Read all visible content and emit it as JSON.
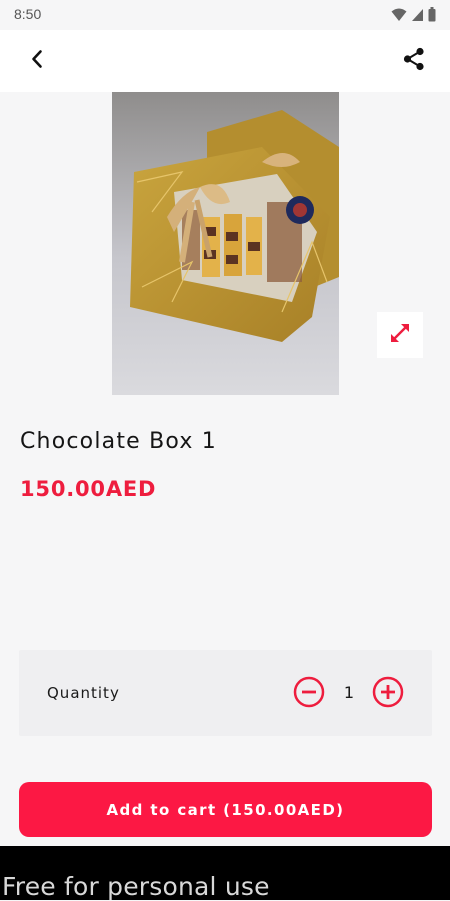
{
  "status_bar": {
    "time": "8:50",
    "icons": [
      "wifi-icon",
      "signal-icon",
      "battery-icon"
    ]
  },
  "app_bar": {
    "back_icon": "back-arrow-icon",
    "share_icon": "share-icon"
  },
  "product": {
    "image_icon": "product-photo",
    "expand_icon": "expand-icon",
    "title": "Chocolate Box 1",
    "price": "150.00AED"
  },
  "quantity": {
    "label": "Quantity",
    "value": "1",
    "minus_icon": "minus-circle-icon",
    "plus_icon": "plus-circle-icon"
  },
  "cart": {
    "button_label": "Add to cart (150.00AED)"
  },
  "watermark": {
    "text": "Free for personal use"
  },
  "colors": {
    "accent": "#ee1d3e",
    "button": "#fc1844",
    "background": "#f6f6f7",
    "card": "#efeff1"
  }
}
